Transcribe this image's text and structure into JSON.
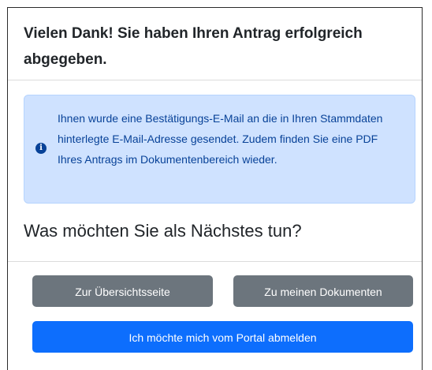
{
  "header": {
    "title": "Vielen Dank! Sie haben Ihren Antrag erfolgreich abgegeben."
  },
  "alert": {
    "icon": "info-circle-icon",
    "text": "Ihnen wurde eine Bestätigungs-E-Mail an die in Ihren Stammdaten hinterlegte E-Mail-Adresse gesendet. Zudem finden Sie eine PDF Ihres Antrags im Dokumentenbereich wieder."
  },
  "next_steps": {
    "question": "Was möchten Sie als Nächstes tun?",
    "overview_label": "Zur Übersichtsseite",
    "documents_label": "Zu meinen Dokumenten",
    "logout_label": "Ich möchte mich vom Portal abmelden"
  },
  "colors": {
    "primary": "#0d6efd",
    "secondary": "#6c757d",
    "alert_bg": "#cfe2ff",
    "alert_text": "#084298"
  }
}
